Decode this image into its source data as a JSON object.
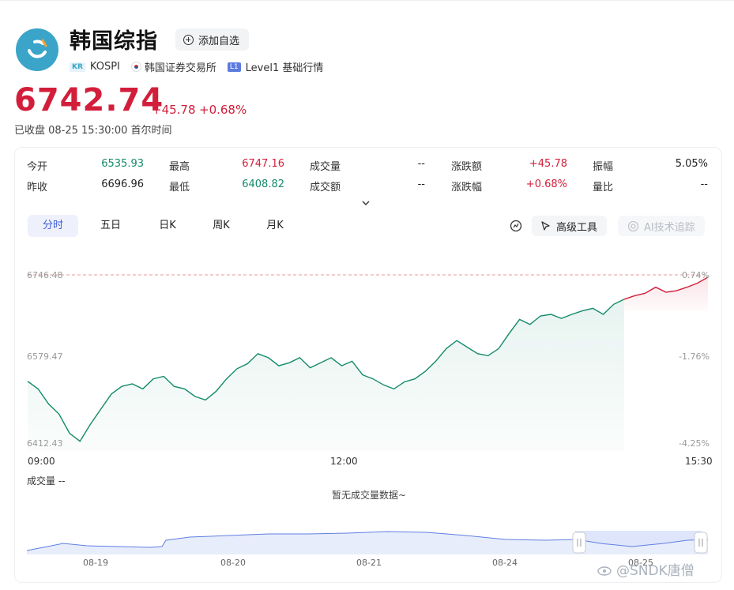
{
  "header": {
    "title": "韩国综指",
    "add_label": "添加自选",
    "tags": {
      "code_badge": "KR",
      "code": "KOSPI",
      "exchange": "韩国证券交易所",
      "level_badge": "L1",
      "level": "Level1 基础行情"
    }
  },
  "quote": {
    "price": "6742.74",
    "change": "+45.78",
    "change_pct": "+0.68%",
    "status": "已收盘  08-25 15:30:00 首尔时间"
  },
  "stats": [
    {
      "label": "今开",
      "value": "6535.93"
    },
    {
      "label": "昨收",
      "value": "6696.96"
    },
    {
      "label": "最高",
      "value": "6747.16"
    },
    {
      "label": "最低",
      "value": "6408.82"
    },
    {
      "label": "成交量",
      "value": "--"
    },
    {
      "label": "成交额",
      "value": "--"
    },
    {
      "label": "涨跌额",
      "value": "+45.78"
    },
    {
      "label": "涨跌幅",
      "value": "+0.68%"
    },
    {
      "label": "振幅",
      "value": "5.05%"
    },
    {
      "label": "量比",
      "value": "--"
    }
  ],
  "tabs": [
    "分时",
    "五日",
    "日K",
    "周K",
    "月K"
  ],
  "tools": {
    "advanced": "高级工具",
    "ai": "AI技术追踪"
  },
  "chart_data": {
    "type": "line",
    "y_axis_left": [
      "6746.48",
      "6579.47",
      "6412.43"
    ],
    "y_axis_right": [
      "0.74%",
      "-1.76%",
      "-4.25%"
    ],
    "x_labels": [
      "09:00",
      "12:00",
      "15:30"
    ],
    "ylim": [
      6412.43,
      6746.48
    ],
    "reference_line": 6746.48,
    "color_below_prev_close": "#138a6a",
    "color_above_prev_close": "#d21e3a",
    "prev_close": 6696.96,
    "series": [
      {
        "x": [
          0,
          6,
          12,
          18,
          24,
          30,
          36,
          42,
          48,
          54,
          60,
          66,
          72,
          78,
          84,
          90,
          96,
          102,
          108,
          114,
          120,
          126,
          132,
          138,
          144,
          150,
          156,
          162,
          168,
          174,
          180,
          186,
          192,
          198,
          204,
          210,
          216,
          222,
          228,
          234,
          240,
          246,
          252,
          258,
          264,
          270,
          276,
          282,
          288,
          294,
          300,
          306,
          312,
          318,
          324,
          330,
          336,
          342,
          348,
          354,
          360,
          366,
          372,
          378,
          384,
          390
        ],
        "values": [
          6535,
          6520,
          6490,
          6470,
          6432,
          6416,
          6450,
          6480,
          6510,
          6525,
          6530,
          6520,
          6540,
          6545,
          6525,
          6520,
          6505,
          6498,
          6515,
          6540,
          6560,
          6570,
          6590,
          6582,
          6566,
          6572,
          6582,
          6562,
          6572,
          6582,
          6566,
          6575,
          6548,
          6540,
          6528,
          6520,
          6534,
          6540,
          6555,
          6575,
          6600,
          6616,
          6603,
          6590,
          6586,
          6600,
          6630,
          6658,
          6648,
          6665,
          6668,
          6660,
          6668,
          6675,
          6680,
          6668,
          6688,
          6698,
          6705,
          6710,
          6722,
          6712,
          6715,
          6722,
          6730,
          6742
        ]
      }
    ]
  },
  "volume": {
    "label": "成交量 --",
    "empty": "暂无成交量数据~"
  },
  "navigator": {
    "dates": [
      "08-19",
      "08-20",
      "08-21",
      "08-24",
      "08-25"
    ]
  },
  "watermark": "@SNDK唐僧"
}
